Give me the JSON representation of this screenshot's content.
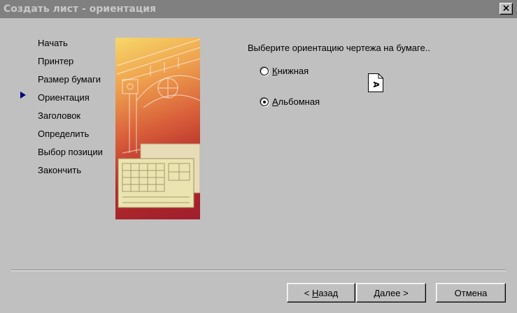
{
  "window": {
    "title": "Создать лист - ориентация",
    "close_glyph": "×"
  },
  "steps": [
    {
      "label": "Начать"
    },
    {
      "label": "Принтер"
    },
    {
      "label": "Размер бумаги"
    },
    {
      "label": "Ориентация",
      "current": true
    },
    {
      "label": "Заголовок"
    },
    {
      "label": "Определить"
    },
    {
      "label": "Выбор позиции"
    },
    {
      "label": "Закончить"
    }
  ],
  "orientation": {
    "prompt": "Выберите ориентацию чертежа на бумаге..",
    "options": [
      {
        "accel": "К",
        "rest": "нижная",
        "checked": false
      },
      {
        "accel": "А",
        "rest": "льбомная",
        "checked": true
      }
    ],
    "preview_glyph": "A"
  },
  "buttons": {
    "back": {
      "prefix": "<",
      "accel": "Н",
      "rest": "азад"
    },
    "next": {
      "label": "Далее",
      "suffix": ">"
    },
    "cancel": {
      "label": "Отмена"
    }
  },
  "colors": {
    "titlebar": "#808080",
    "title_text": "#c8c8c8",
    "dialog": "#c0c0c0",
    "arrow": "#000080"
  }
}
